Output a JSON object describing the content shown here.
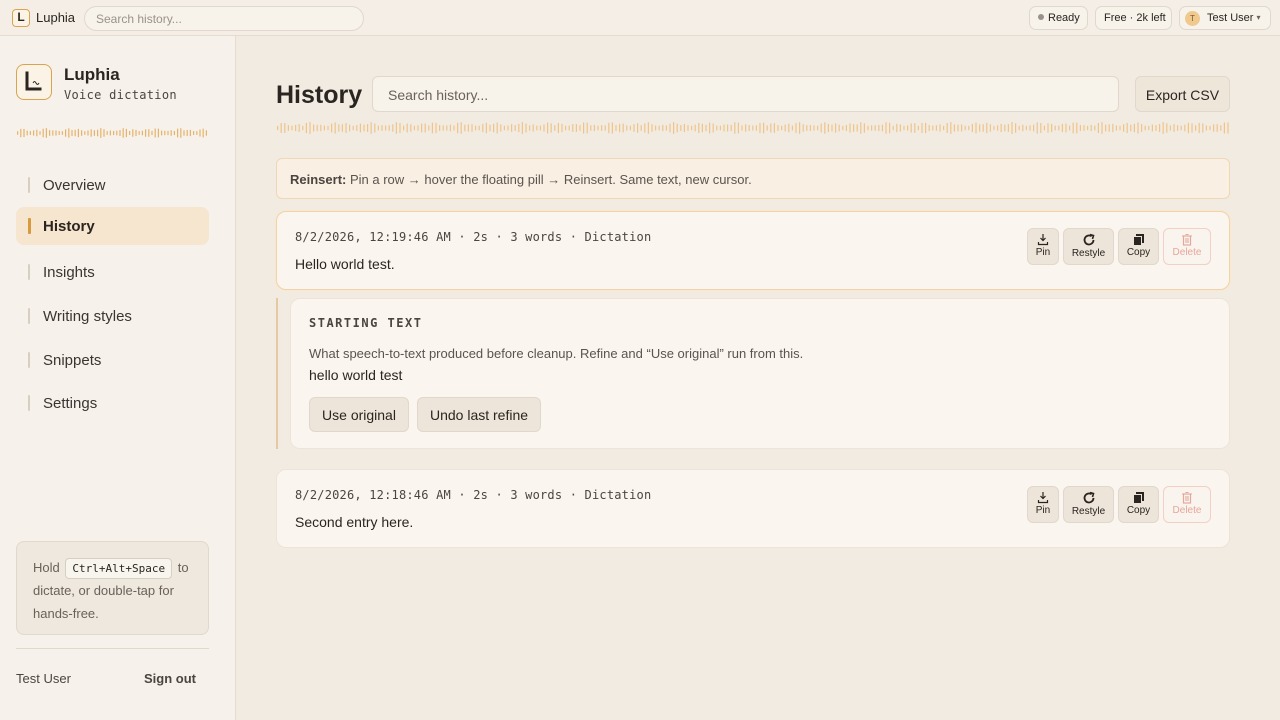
{
  "topbar": {
    "logo_letter": "L",
    "app_name": "Luphia",
    "search_placeholder": "Search history...",
    "status": "Ready",
    "plan": "Free · 2k left",
    "avatar_initial": "T",
    "user_name": "Test User"
  },
  "sidebar": {
    "title": "Luphia",
    "subtitle": "Voice dictation",
    "nav": [
      {
        "label": "Overview",
        "active": false
      },
      {
        "label": "History",
        "active": true
      },
      {
        "label": "Insights",
        "active": false
      },
      {
        "label": "Writing styles",
        "active": false
      },
      {
        "label": "Snippets",
        "active": false
      },
      {
        "label": "Settings",
        "active": false
      }
    ],
    "hint": {
      "before": "Hold",
      "shortcut": "Ctrl+Alt+Space",
      "after": "to dictate, or double-tap for hands-free."
    },
    "user_name": "Test User",
    "sign_out": "Sign out"
  },
  "main": {
    "title": "History",
    "search_placeholder": "Search history...",
    "export_label": "Export CSV",
    "tip": {
      "bold": "Reinsert:",
      "text": "Pin a row → hover the floating pill → Reinsert. Same text, new cursor."
    },
    "entries": [
      {
        "meta": "8/2/2026, 12:19:46 AM · 2s · 3 words · Dictation",
        "text": "Hello world test.",
        "actions": {
          "pin": "Pin",
          "restyle": "Restyle",
          "copy": "Copy",
          "delete": "Delete"
        }
      },
      {
        "meta": "8/2/2026, 12:18:46 AM · 2s · 3 words · Dictation",
        "text": "Second entry here.",
        "actions": {
          "pin": "Pin",
          "restyle": "Restyle",
          "copy": "Copy",
          "delete": "Delete"
        }
      }
    ],
    "starting_text": {
      "label": "STARTING TEXT",
      "description": "What speech-to-text produced before cleanup. Refine and “Use original” run from this.",
      "raw": "hello world test",
      "use_original": "Use original",
      "undo_refine": "Undo last refine"
    }
  },
  "colors": {
    "accent": "#d89a3e",
    "background": "#f2ebe2",
    "delete": "#e5a79a"
  },
  "icons": [
    "logo-icon",
    "status-dot-icon",
    "avatar-icon",
    "chevron-down-icon",
    "waveform-icon",
    "pin-icon",
    "restyle-icon",
    "copy-icon",
    "trash-icon"
  ]
}
